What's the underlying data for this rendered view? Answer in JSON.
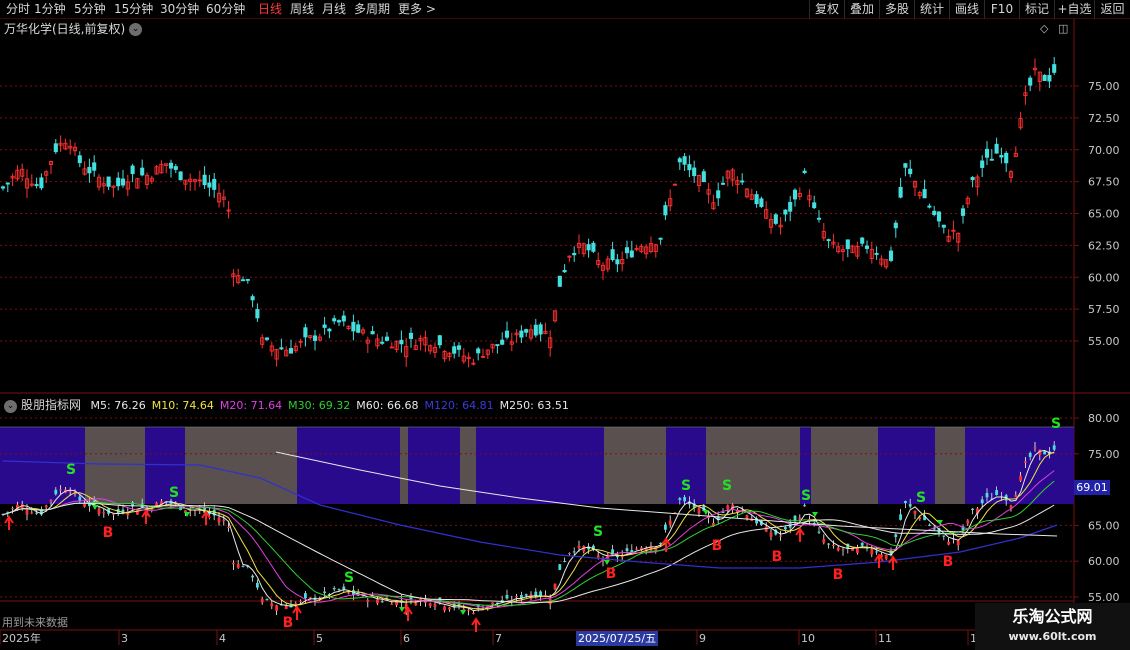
{
  "periods": [
    "分时",
    "1分钟",
    "5分钟",
    "15分钟",
    "30分钟",
    "60分钟",
    "日线",
    "周线",
    "月线",
    "多周期",
    "更多 >"
  ],
  "active_period": "日线",
  "tools": [
    "复权",
    "叠加",
    "多股",
    "统计",
    "画线",
    "F10",
    "标记",
    "+自选",
    "返回"
  ],
  "stock_title": "万华化学(日线,前复权)",
  "price_axis": [
    "75.00",
    "72.50",
    "70.00",
    "67.50",
    "65.00",
    "62.50",
    "60.00",
    "57.50",
    "55.00"
  ],
  "indicator": {
    "name": "股朋指标网",
    "items": [
      {
        "text": "M5: 76.26",
        "color": "#e8e8e8"
      },
      {
        "text": "M10: 74.64",
        "color": "#f0e442"
      },
      {
        "text": "M20: 71.64",
        "color": "#e040e0"
      },
      {
        "text": "M30: 69.32",
        "color": "#30d030"
      },
      {
        "text": "M60: 66.68",
        "color": "#e8e8e8"
      },
      {
        "text": "M120: 64.81",
        "color": "#3a3ae0"
      },
      {
        "text": "M250: 63.51",
        "color": "#e8e8e8"
      }
    ]
  },
  "indicator_axis": [
    "80.00",
    "75.00",
    "65.00",
    "60.00",
    "55.00"
  ],
  "price_badge": "69.01",
  "future_note": "用到未来数据",
  "dates": [
    "2025年",
    "3",
    "4",
    "5",
    "6",
    "7",
    "9",
    "10",
    "11",
    "1"
  ],
  "date_highlight": "2025/07/25/五",
  "watermark": {
    "title": "乐淘公式网",
    "url": "www.60lt.com"
  },
  "signal_letters": {
    "buy": "B",
    "sell": "S"
  },
  "colors": {
    "up": "#ff3030",
    "down": "#44e0e0",
    "purple": "#2a0a8c",
    "gray": "#5a5050"
  }
}
